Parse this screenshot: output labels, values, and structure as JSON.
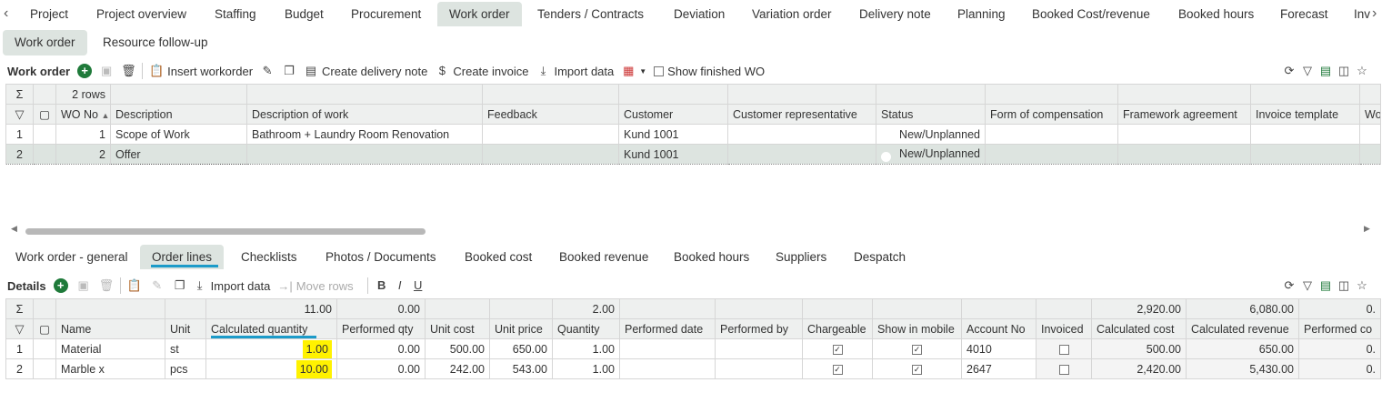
{
  "top_tabs": [
    "Project",
    "Project overview",
    "Staffing",
    "Budget",
    "Procurement",
    "Work order",
    "Tenders / Contracts",
    "Deviation",
    "Variation order",
    "Delivery note",
    "Planning",
    "Booked Cost/revenue",
    "Booked hours",
    "Forecast",
    "Inv"
  ],
  "active_top_tab": "Work order",
  "sub_tabs": [
    "Work order",
    "Resource follow-up"
  ],
  "wo_toolbar": {
    "title": "Work order",
    "insert_workorder": "Insert workorder",
    "create_delivery_note": "Create delivery note",
    "create_invoice": "Create invoice",
    "import_data": "Import data",
    "show_finished": "Show finished WO"
  },
  "wo_grid": {
    "row_count": "2 rows",
    "columns": [
      "WO No",
      "Description",
      "Description of work",
      "Feedback",
      "Customer",
      "Customer representative",
      "Status",
      "Form of compensation",
      "Framework agreement",
      "Invoice template",
      "Wo"
    ],
    "rows": [
      {
        "idx": "1",
        "wo_no": "1",
        "description": "Scope of Work",
        "description_of_work": "Bathroom + Laundry Room Renovation",
        "feedback": "",
        "customer": "Kund 1001",
        "rep": "",
        "status": "New/Unplanned"
      },
      {
        "idx": "2",
        "wo_no": "2",
        "description": "Offer",
        "description_of_work": "",
        "feedback": "",
        "customer": "Kund 1001",
        "rep": "",
        "status": "New/Unplanned"
      }
    ]
  },
  "bottom_tabs": [
    "Work order - general",
    "Order lines",
    "Checklists",
    "Photos / Documents",
    "Booked cost",
    "Booked revenue",
    "Booked hours",
    "Suppliers",
    "Despatch"
  ],
  "active_bottom_tab": "Order lines",
  "details_toolbar": {
    "title": "Details",
    "import_data": "Import data",
    "move_rows": "Move rows"
  },
  "details_grid": {
    "sums": {
      "calc_qty": "11.00",
      "performed_qty": "0.00",
      "quantity": "2.00",
      "calc_cost": "2,920.00",
      "calc_revenue": "6,080.00",
      "performed_cost": "0."
    },
    "columns": [
      "Name",
      "Unit",
      "Calculated quantity",
      "Performed qty",
      "Unit cost",
      "Unit price",
      "Quantity",
      "Performed date",
      "Performed by",
      "Chargeable",
      "Show in mobile",
      "Account No",
      "Invoiced",
      "Calculated cost",
      "Calculated revenue",
      "Performed co"
    ],
    "rows": [
      {
        "idx": "1",
        "name": "Material",
        "unit": "st",
        "calc_qty": "1.00",
        "performed_qty": "0.00",
        "unit_cost": "500.00",
        "unit_price": "650.00",
        "quantity": "1.00",
        "performed_date": "",
        "performed_by": "",
        "chargeable": true,
        "show_mobile": true,
        "account_no": "4010",
        "invoiced": false,
        "calc_cost": "500.00",
        "calc_revenue": "650.00",
        "performed_cost": "0."
      },
      {
        "idx": "2",
        "name": "Marble x",
        "unit": "pcs",
        "calc_qty": "10.00",
        "performed_qty": "0.00",
        "unit_cost": "242.00",
        "unit_price": "543.00",
        "quantity": "1.00",
        "performed_date": "",
        "performed_by": "",
        "chargeable": true,
        "show_mobile": true,
        "account_no": "2647",
        "invoiced": false,
        "calc_cost": "2,420.00",
        "calc_revenue": "5,430.00",
        "performed_cost": "0."
      }
    ]
  },
  "colors": {
    "accent_underline": "#1c9bc9",
    "active_tab_bg": "#dde4e0",
    "highlight": "#fff200",
    "add_green": "#1f7a3a"
  }
}
